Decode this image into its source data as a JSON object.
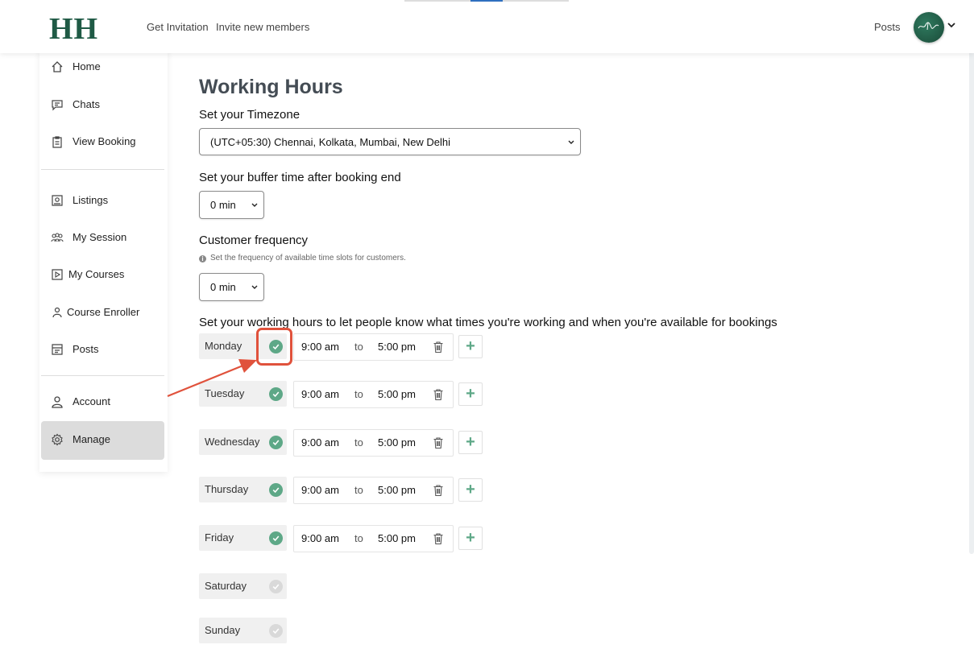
{
  "header": {
    "logo": "HH",
    "links": {
      "get_invitation": "Get Invitation",
      "invite_members": "Invite new members",
      "posts": "Posts"
    }
  },
  "sidebar": {
    "items": [
      {
        "label": "Home",
        "icon": "home-icon"
      },
      {
        "label": "Chats",
        "icon": "chat-icon"
      },
      {
        "label": "View Booking",
        "icon": "clipboard-icon"
      },
      {
        "label": "Listings",
        "icon": "listing-icon"
      },
      {
        "label": "My Session",
        "icon": "group-icon"
      },
      {
        "label": "My Courses",
        "icon": "play-icon"
      },
      {
        "label": "Course Enroller",
        "icon": "user-icon"
      },
      {
        "label": "Posts",
        "icon": "posts-icon"
      },
      {
        "label": "Account",
        "icon": "account-icon"
      },
      {
        "label": "Manage",
        "icon": "gear-icon"
      }
    ],
    "active": "Manage"
  },
  "main": {
    "title": "Working Hours",
    "timezone_label": "Set your Timezone",
    "timezone_value": "(UTC+05:30) Chennai, Kolkata, Mumbai, New Delhi",
    "buffer_label": "Set your buffer time after booking end",
    "buffer_value": "0 min",
    "frequency_label": "Customer frequency",
    "frequency_help": "Set the frequency of available time slots for customers.",
    "frequency_value": "0 min",
    "intro": "Set your working hours to let people know what times you're working and when you're available for bookings",
    "to_label": "to",
    "add_label": "+",
    "days": [
      {
        "name": "Monday",
        "enabled": true,
        "start": "9:00 am",
        "end": "5:00 pm"
      },
      {
        "name": "Tuesday",
        "enabled": true,
        "start": "9:00 am",
        "end": "5:00 pm"
      },
      {
        "name": "Wednesday",
        "enabled": true,
        "start": "9:00 am",
        "end": "5:00 pm"
      },
      {
        "name": "Thursday",
        "enabled": true,
        "start": "9:00 am",
        "end": "5:00 pm"
      },
      {
        "name": "Friday",
        "enabled": true,
        "start": "9:00 am",
        "end": "5:00 pm"
      },
      {
        "name": "Saturday",
        "enabled": false
      },
      {
        "name": "Sunday",
        "enabled": false
      }
    ]
  },
  "colors": {
    "brand": "#1f5a45",
    "check_on": "#5ea887",
    "check_off": "#d9d9d9",
    "annotation": "#e0523c"
  }
}
